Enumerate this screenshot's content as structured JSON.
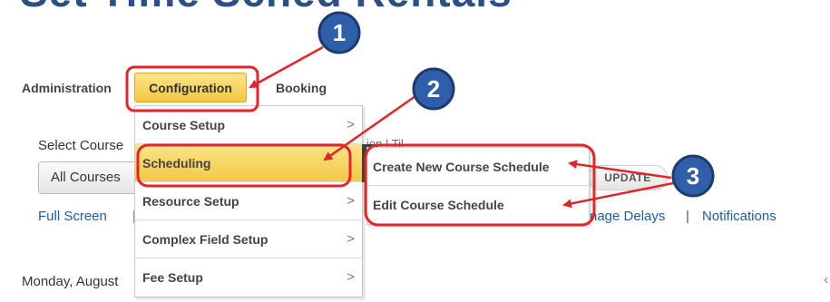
{
  "page_title_fragment": "Set Time Sched Rentals",
  "nav": {
    "administration": "Administration",
    "configuration": "Configuration",
    "booking": "Booking"
  },
  "background": {
    "select_course_label": "Select Course",
    "course_select_value": "All Courses",
    "til_fragment": "ion | Til",
    "update_button": "UPDATE",
    "full_screen_link": "Full Screen",
    "pipe_fragment": "|",
    "manage_delays_link": "nage Delays",
    "separator": "|",
    "notifications_link": "Notifications",
    "date_text": "Monday, August",
    "edge_mark": "‹"
  },
  "config_menu": {
    "items": [
      {
        "label": "Course Setup",
        "chevron": ">"
      },
      {
        "label": "Scheduling",
        "chevron": ">"
      },
      {
        "label": "Resource Setup",
        "chevron": ">"
      },
      {
        "label": "Complex Field Setup",
        "chevron": ">"
      },
      {
        "label": "Fee Setup",
        "chevron": ">"
      }
    ],
    "active_index": 1
  },
  "scheduling_submenu": {
    "items": [
      {
        "label": "Create New Course Schedule"
      },
      {
        "label": "Edit Course Schedule"
      }
    ]
  },
  "annotations": {
    "badges": [
      "1",
      "2",
      "3"
    ],
    "highlight_color": "#e0262b",
    "badge_color": "#2f5fa8",
    "badge_border_color": "#1c3c70"
  }
}
